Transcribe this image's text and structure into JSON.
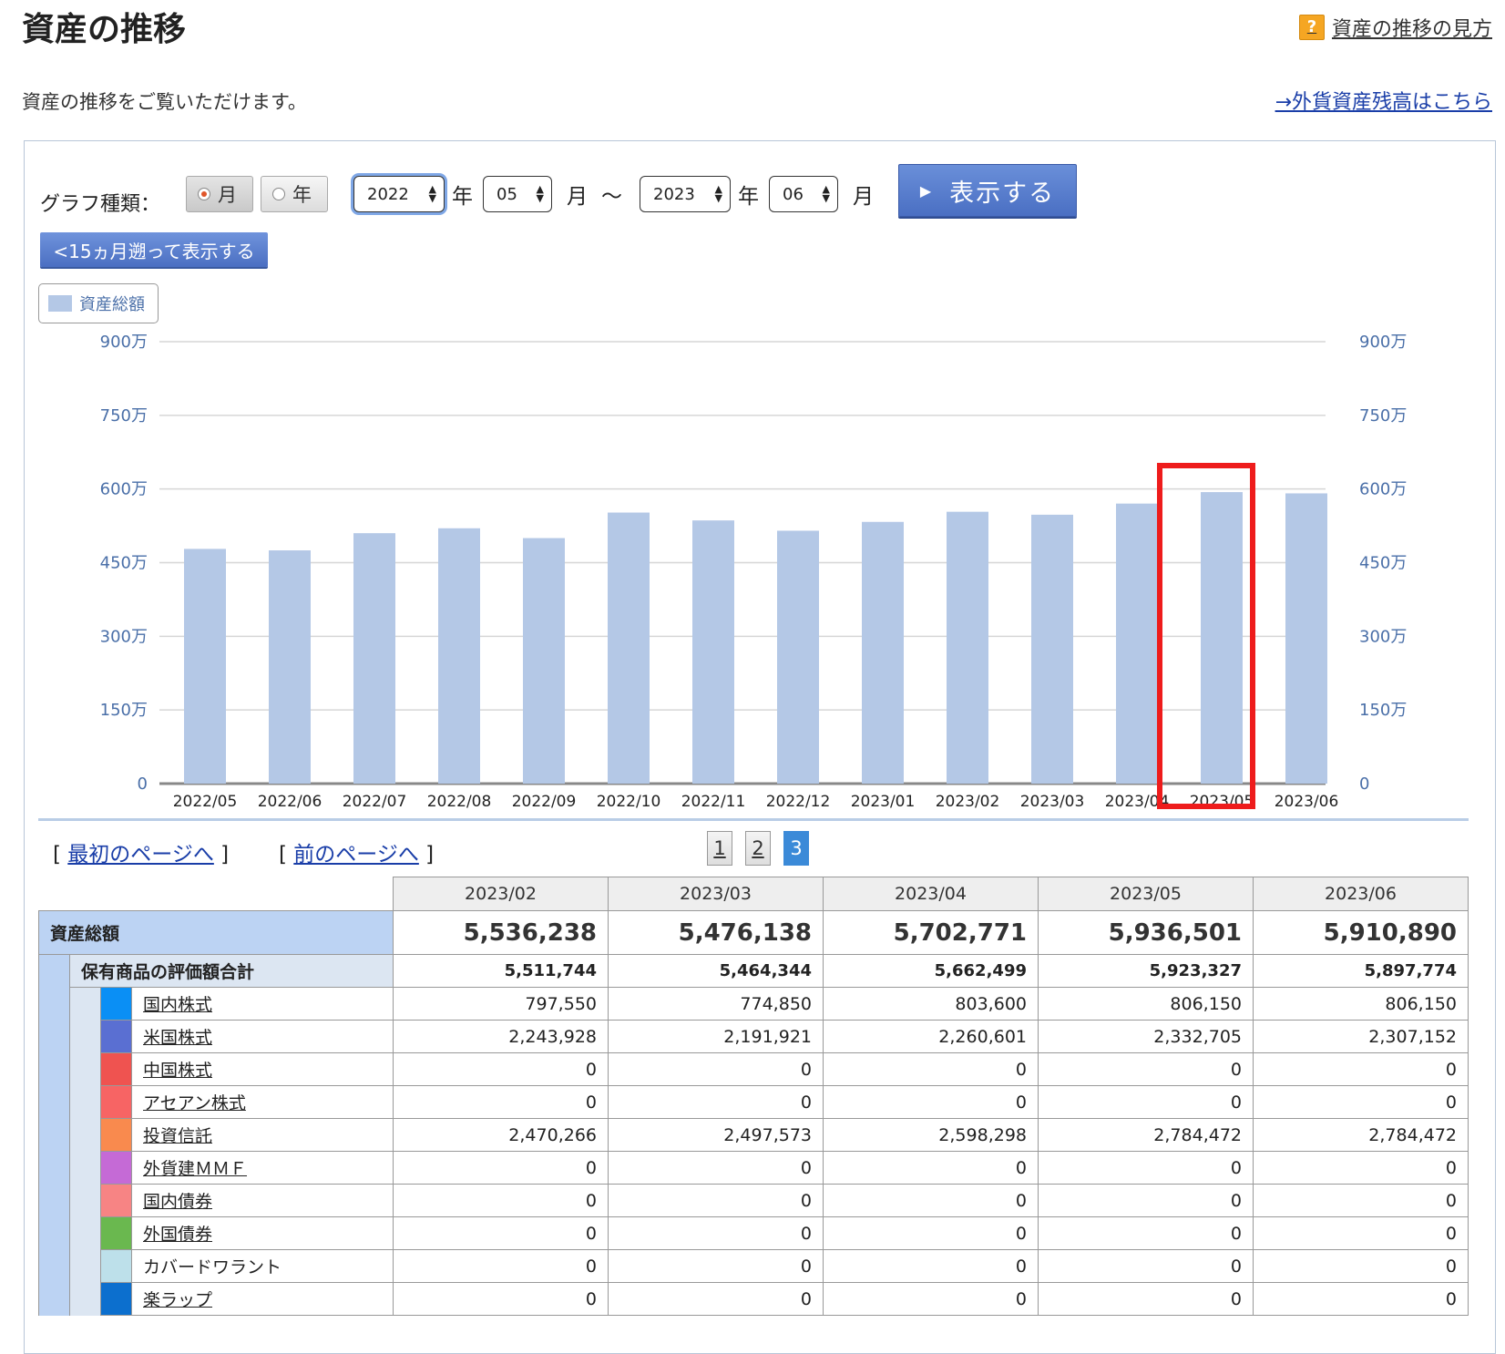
{
  "header": {
    "title": "資産の推移",
    "help_link": "資産の推移の見方",
    "help_icon": "question-icon",
    "intro": "資産の推移をご覧いただけます。",
    "fx_link": "→外貨資産残高はこちら"
  },
  "controls": {
    "graph_type_label": "グラフ種類：",
    "radio_month": "月",
    "radio_year": "年",
    "selected_type": "月",
    "start_year": "2022",
    "start_month": "05",
    "end_year": "2023",
    "end_month": "06",
    "year_unit": "年",
    "month_unit": "月",
    "range_sep": "〜",
    "show_button": "表示する",
    "back_button": "<15ヵ月遡って表示する"
  },
  "legend": {
    "label": "資産総額",
    "color": "#b4c8e6"
  },
  "chart_data": {
    "type": "bar",
    "categories": [
      "2022/05",
      "2022/06",
      "2022/07",
      "2022/08",
      "2022/09",
      "2022/10",
      "2022/11",
      "2022/12",
      "2023/01",
      "2023/02",
      "2023/03",
      "2023/04",
      "2023/05",
      "2023/06"
    ],
    "series": [
      {
        "name": "資産総額",
        "values": [
          4780000,
          4750000,
          5100000,
          5200000,
          5000000,
          5520000,
          5360000,
          5150000,
          5330000,
          5536238,
          5476138,
          5702771,
          5936501,
          5910890
        ],
        "color": "#b4c8e6"
      }
    ],
    "y_ticks": [
      "0",
      "150万",
      "300万",
      "450万",
      "600万",
      "750万",
      "900万"
    ],
    "ylim": [
      0,
      9000000
    ],
    "grid": true,
    "highlighted_category": "2023/05"
  },
  "pager": {
    "first": "最初のページへ",
    "prev": "前のページへ",
    "pages": [
      "1",
      "2",
      "3"
    ],
    "current": "3"
  },
  "table": {
    "columns": [
      "2023/02",
      "2023/03",
      "2023/04",
      "2023/05",
      "2023/06"
    ],
    "total": {
      "label": "資産総額",
      "values": [
        "5,536,238",
        "5,476,138",
        "5,702,771",
        "5,936,501",
        "5,910,890"
      ]
    },
    "subtotal": {
      "label": "保有商品の評価額合計",
      "values": [
        "5,511,744",
        "5,464,344",
        "5,662,499",
        "5,923,327",
        "5,897,774"
      ]
    },
    "rows": [
      {
        "label": "国内株式",
        "color": "#0a8ff5",
        "link": true,
        "values": [
          "797,550",
          "774,850",
          "803,600",
          "806,150",
          "806,150"
        ]
      },
      {
        "label": "米国株式",
        "color": "#5a6fd2",
        "link": true,
        "values": [
          "2,243,928",
          "2,191,921",
          "2,260,601",
          "2,332,705",
          "2,307,152"
        ]
      },
      {
        "label": "中国株式",
        "color": "#ef5350",
        "link": true,
        "values": [
          "0",
          "0",
          "0",
          "0",
          "0"
        ]
      },
      {
        "label": "アセアン株式",
        "color": "#f76464",
        "link": true,
        "values": [
          "0",
          "0",
          "0",
          "0",
          "0"
        ]
      },
      {
        "label": "投資信託",
        "color": "#f98a4e",
        "link": true,
        "values": [
          "2,470,266",
          "2,497,573",
          "2,598,298",
          "2,784,472",
          "2,784,472"
        ]
      },
      {
        "label": "外貨建ＭＭＦ",
        "color": "#c56ad6",
        "link": true,
        "values": [
          "0",
          "0",
          "0",
          "0",
          "0"
        ]
      },
      {
        "label": "国内債券",
        "color": "#f78484",
        "link": true,
        "values": [
          "0",
          "0",
          "0",
          "0",
          "0"
        ]
      },
      {
        "label": "外国債券",
        "color": "#6ab84f",
        "link": true,
        "values": [
          "0",
          "0",
          "0",
          "0",
          "0"
        ]
      },
      {
        "label": "カバードワラント",
        "color": "#bde0ea",
        "link": false,
        "values": [
          "0",
          "0",
          "0",
          "0",
          "0"
        ]
      },
      {
        "label": "楽ラップ",
        "color": "#0c6fce",
        "link": true,
        "values": [
          "0",
          "0",
          "0",
          "0",
          "0"
        ]
      }
    ]
  }
}
